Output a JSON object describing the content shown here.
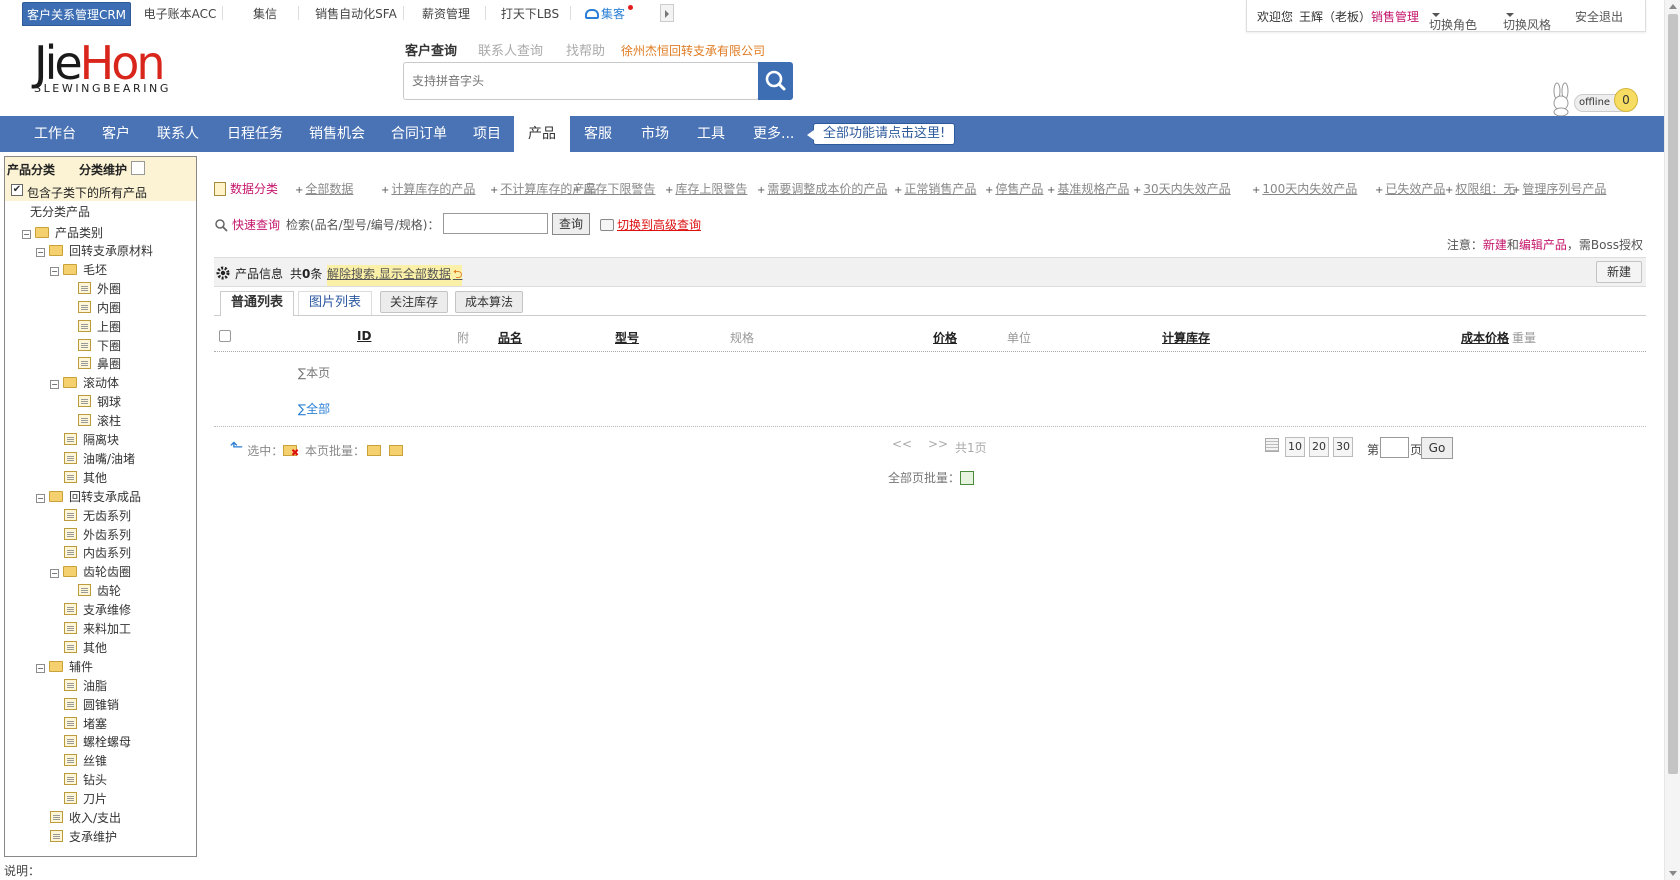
{
  "topbar": {
    "tabs": [
      "客户关系管理CRM",
      "电子账本ACC",
      "集信",
      "销售自动化SFA",
      "薪资管理",
      "打天下LBS",
      "集客"
    ],
    "active_tab": "客户关系管理CRM",
    "welcome": "欢迎您",
    "user_name": "王辉（老板）",
    "user_role_link": "销售管理",
    "switch_role": "切换角色",
    "switch_style": "切换风格",
    "logout": "安全退出"
  },
  "logo": {
    "main_prefix": "Jie",
    "main_suffix": "Hon",
    "sub": "SLEWINGBEARING"
  },
  "search": {
    "tabs": [
      "客户查询",
      "联系人查询",
      "找帮助"
    ],
    "company": "徐州杰恒回转支承有限公司",
    "placeholder": "支持拼音字头"
  },
  "offline": {
    "label": "offline",
    "count": "0"
  },
  "mainnav": {
    "items": [
      "工作台",
      "客户",
      "联系人",
      "日程任务",
      "销售机会",
      "合同订单",
      "项目",
      "产品",
      "客服",
      "市场",
      "工具",
      "更多..."
    ],
    "active": "产品",
    "all_functions": "全部功能请点击这里!"
  },
  "sidebar": {
    "title": "产品分类",
    "maintain": "分类维护",
    "include_children": "包含子类下的所有产品",
    "uncategorized": "无分类产品",
    "root": "产品类别",
    "nodes": [
      {
        "label": "回转支承原材料",
        "level": 1,
        "type": "folder"
      },
      {
        "label": "毛坯",
        "level": 2,
        "type": "folder"
      },
      {
        "label": "外圈",
        "level": 3,
        "type": "leaf"
      },
      {
        "label": "内圈",
        "level": 3,
        "type": "leaf"
      },
      {
        "label": "上圈",
        "level": 3,
        "type": "leaf"
      },
      {
        "label": "下圈",
        "level": 3,
        "type": "leaf"
      },
      {
        "label": "鼻圈",
        "level": 3,
        "type": "leaf"
      },
      {
        "label": "滚动体",
        "level": 2,
        "type": "folder"
      },
      {
        "label": "钢球",
        "level": 3,
        "type": "leaf"
      },
      {
        "label": "滚柱",
        "level": 3,
        "type": "leaf"
      },
      {
        "label": "隔离块",
        "level": 2,
        "type": "leaf"
      },
      {
        "label": "油嘴/油堵",
        "level": 2,
        "type": "leaf"
      },
      {
        "label": "其他",
        "level": 2,
        "type": "leaf"
      },
      {
        "label": "回转支承成品",
        "level": 1,
        "type": "folder"
      },
      {
        "label": "无齿系列",
        "level": 2,
        "type": "leaf"
      },
      {
        "label": "外齿系列",
        "level": 2,
        "type": "leaf"
      },
      {
        "label": "内齿系列",
        "level": 2,
        "type": "leaf"
      },
      {
        "label": "齿轮齿圈",
        "level": 2,
        "type": "folder"
      },
      {
        "label": "齿轮",
        "level": 3,
        "type": "leaf"
      },
      {
        "label": "支承维修",
        "level": 2,
        "type": "leaf"
      },
      {
        "label": "来料加工",
        "level": 2,
        "type": "leaf"
      },
      {
        "label": "其他",
        "level": 2,
        "type": "leaf"
      },
      {
        "label": "辅件",
        "level": 1,
        "type": "folder"
      },
      {
        "label": "油脂",
        "level": 2,
        "type": "leaf"
      },
      {
        "label": "圆锥销",
        "level": 2,
        "type": "leaf"
      },
      {
        "label": "堵塞",
        "level": 2,
        "type": "leaf"
      },
      {
        "label": "螺栓螺母",
        "level": 2,
        "type": "leaf"
      },
      {
        "label": "丝锥",
        "level": 2,
        "type": "leaf"
      },
      {
        "label": "钻头",
        "level": 2,
        "type": "leaf"
      },
      {
        "label": "刀片",
        "level": 2,
        "type": "leaf"
      },
      {
        "label": "收入/支出",
        "level": 1,
        "type": "leaf"
      },
      {
        "label": "支承维护",
        "level": 1,
        "type": "leaf"
      }
    ]
  },
  "footer_note": "说明：",
  "filters": {
    "label": "数据分类",
    "items": [
      "全部数据",
      "计算库存的产品",
      "不计算库存的产品",
      "库存下限警告",
      "库存上限警告",
      "需要调整成本价的产品",
      "正常销售产品",
      "停售产品",
      "基准规格产品",
      "30天内失效产品",
      "100天内失效产品",
      "已失效产品",
      "权限组：无",
      "管理序列号产品"
    ]
  },
  "quick_search": {
    "label": "快速查询",
    "field_label": "检索(品名/型号/编号/规格)：",
    "value": "",
    "button": "查询",
    "advanced": "切换到高级查询"
  },
  "notice": {
    "prefix": "注意：",
    "new": "新建",
    "and": "和",
    "edit": "编辑产品",
    "suffix": "，需Boss授权"
  },
  "panel": {
    "title": "产品信息",
    "count_prefix": "共",
    "count": "0",
    "count_suffix": "条",
    "clear_search": "解除搜索,显示全部数据",
    "new_button": "新建"
  },
  "list_tabs": {
    "normal": "普通列表",
    "image": "图片列表",
    "stock": "关注库存",
    "cost": "成本算法"
  },
  "table": {
    "columns": [
      "ID",
      "附",
      "品名",
      "型号",
      "规格",
      "价格",
      "单位",
      "计算库存",
      "成本价格",
      "重量"
    ],
    "sum_page": "∑本页",
    "sum_all": "∑全部"
  },
  "pager": {
    "selected": "选中：",
    "batch_this_page": "本页批量：",
    "prev": "<<",
    "next": ">>",
    "total_pages": "共1页",
    "sizes": [
      "10",
      "20",
      "30"
    ],
    "page_prefix": "第",
    "page_suffix": "页",
    "go": "Go",
    "all_batch": "全部页批量："
  },
  "colors": {
    "nav_blue": "#4a73b5",
    "accent_pink": "#c4156b",
    "company_orange": "#e07b22"
  }
}
